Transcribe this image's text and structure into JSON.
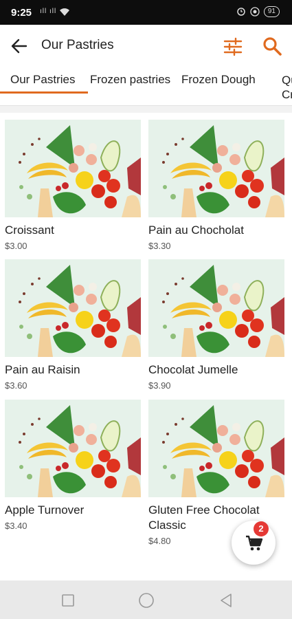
{
  "status_bar": {
    "time": "9:25",
    "left_icons": "ıll ıll",
    "battery": "91",
    "icons": [
      "wifi-icon",
      "alarm-icon",
      "vibrate-icon",
      "battery-icon"
    ]
  },
  "header": {
    "title": "Our Pastries",
    "back_icon": "arrow-left-icon",
    "filter_icon": "sliders-icon",
    "search_icon": "search-icon",
    "accent_color": "#e06a1f"
  },
  "tabs": [
    {
      "label": "Our Pastries",
      "selected": true
    },
    {
      "label": "Frozen pastries",
      "selected": false
    },
    {
      "label": "Frozen Dough",
      "selected": false
    },
    {
      "label": "Qu\nCro",
      "selected": false
    }
  ],
  "products": [
    {
      "name": "Croissant",
      "price": "$3.00"
    },
    {
      "name": "Pain au Chocholat",
      "price": "$3.30"
    },
    {
      "name": "Pain au Raisin",
      "price": "$3.60"
    },
    {
      "name": "Chocolat Jumelle",
      "price": "$3.90"
    },
    {
      "name": "Apple Turnover",
      "price": "$3.40"
    },
    {
      "name": "Gluten Free Chocolat Classic",
      "price": "$4.80"
    }
  ],
  "cart": {
    "count": "2",
    "icon": "cart-icon",
    "badge_color": "#e53935"
  },
  "nav_bar": {
    "icons": [
      "recents-square-icon",
      "home-circle-icon",
      "back-triangle-icon"
    ]
  }
}
